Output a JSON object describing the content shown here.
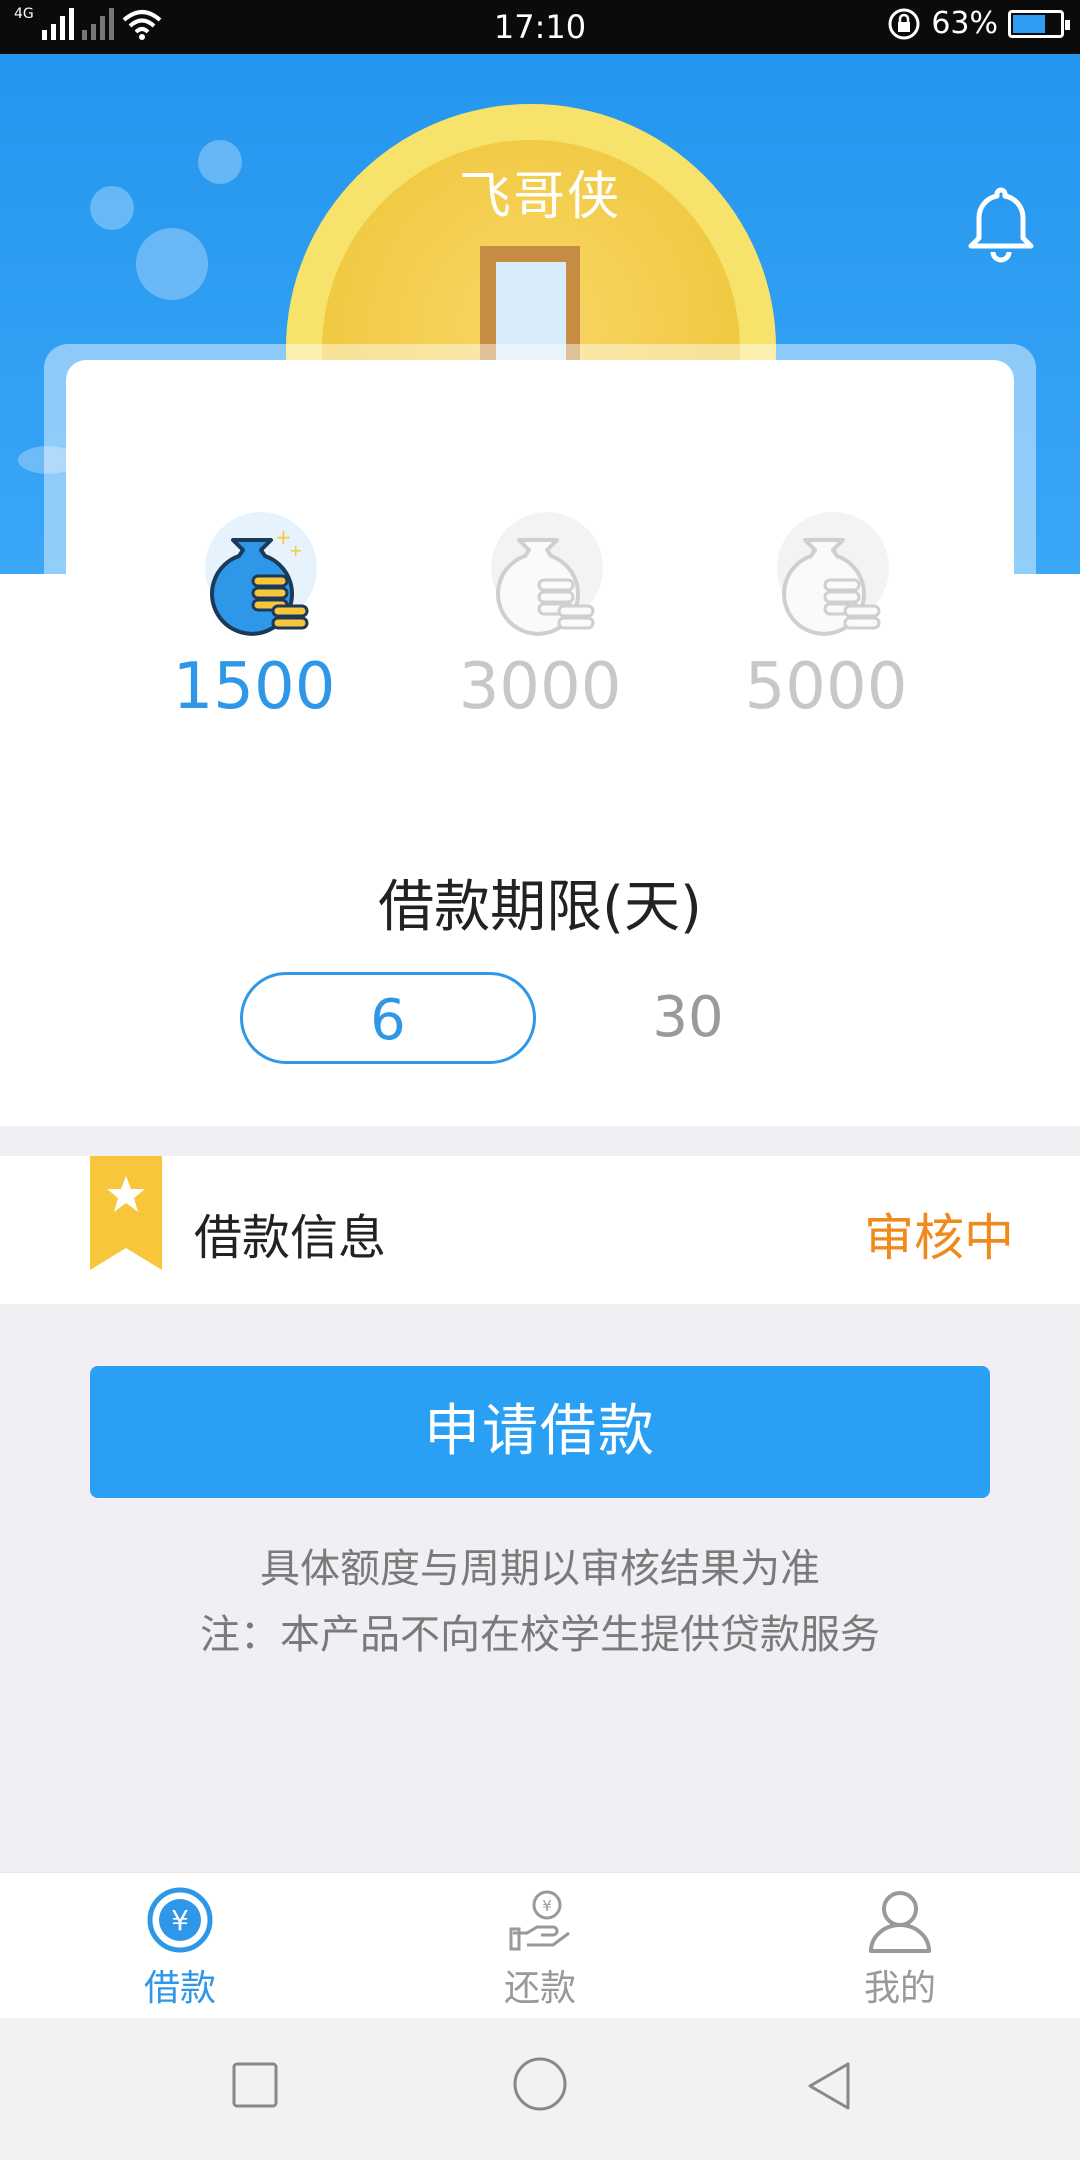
{
  "status_bar": {
    "network_label": "4G",
    "time": "17:10",
    "battery_percent": "63%",
    "battery_level": 0.63
  },
  "header": {
    "app_title": "飞哥侠"
  },
  "amounts": [
    {
      "value": "1500",
      "selected": true
    },
    {
      "value": "3000",
      "selected": false
    },
    {
      "value": "5000",
      "selected": false
    }
  ],
  "term": {
    "title": "借款期限(天)",
    "options": [
      {
        "value": "6",
        "selected": true
      },
      {
        "value": "30",
        "selected": false
      }
    ]
  },
  "loan_info": {
    "label": "借款信息",
    "status": "审核中"
  },
  "apply_button": {
    "label": "申请借款"
  },
  "notes": {
    "line1": "具体额度与周期以审核结果为准",
    "line2": "注：本产品不向在校学生提供贷款服务"
  },
  "tabs": [
    {
      "label": "借款",
      "icon": "yen-circle-icon",
      "active": true
    },
    {
      "label": "还款",
      "icon": "repay-hand-icon",
      "active": false
    },
    {
      "label": "我的",
      "icon": "user-icon",
      "active": false
    }
  ],
  "colors": {
    "accent": "#2e97e8",
    "button": "#2aa0f5",
    "status_orange": "#f08a1c",
    "ribbon": "#f7c63a"
  }
}
